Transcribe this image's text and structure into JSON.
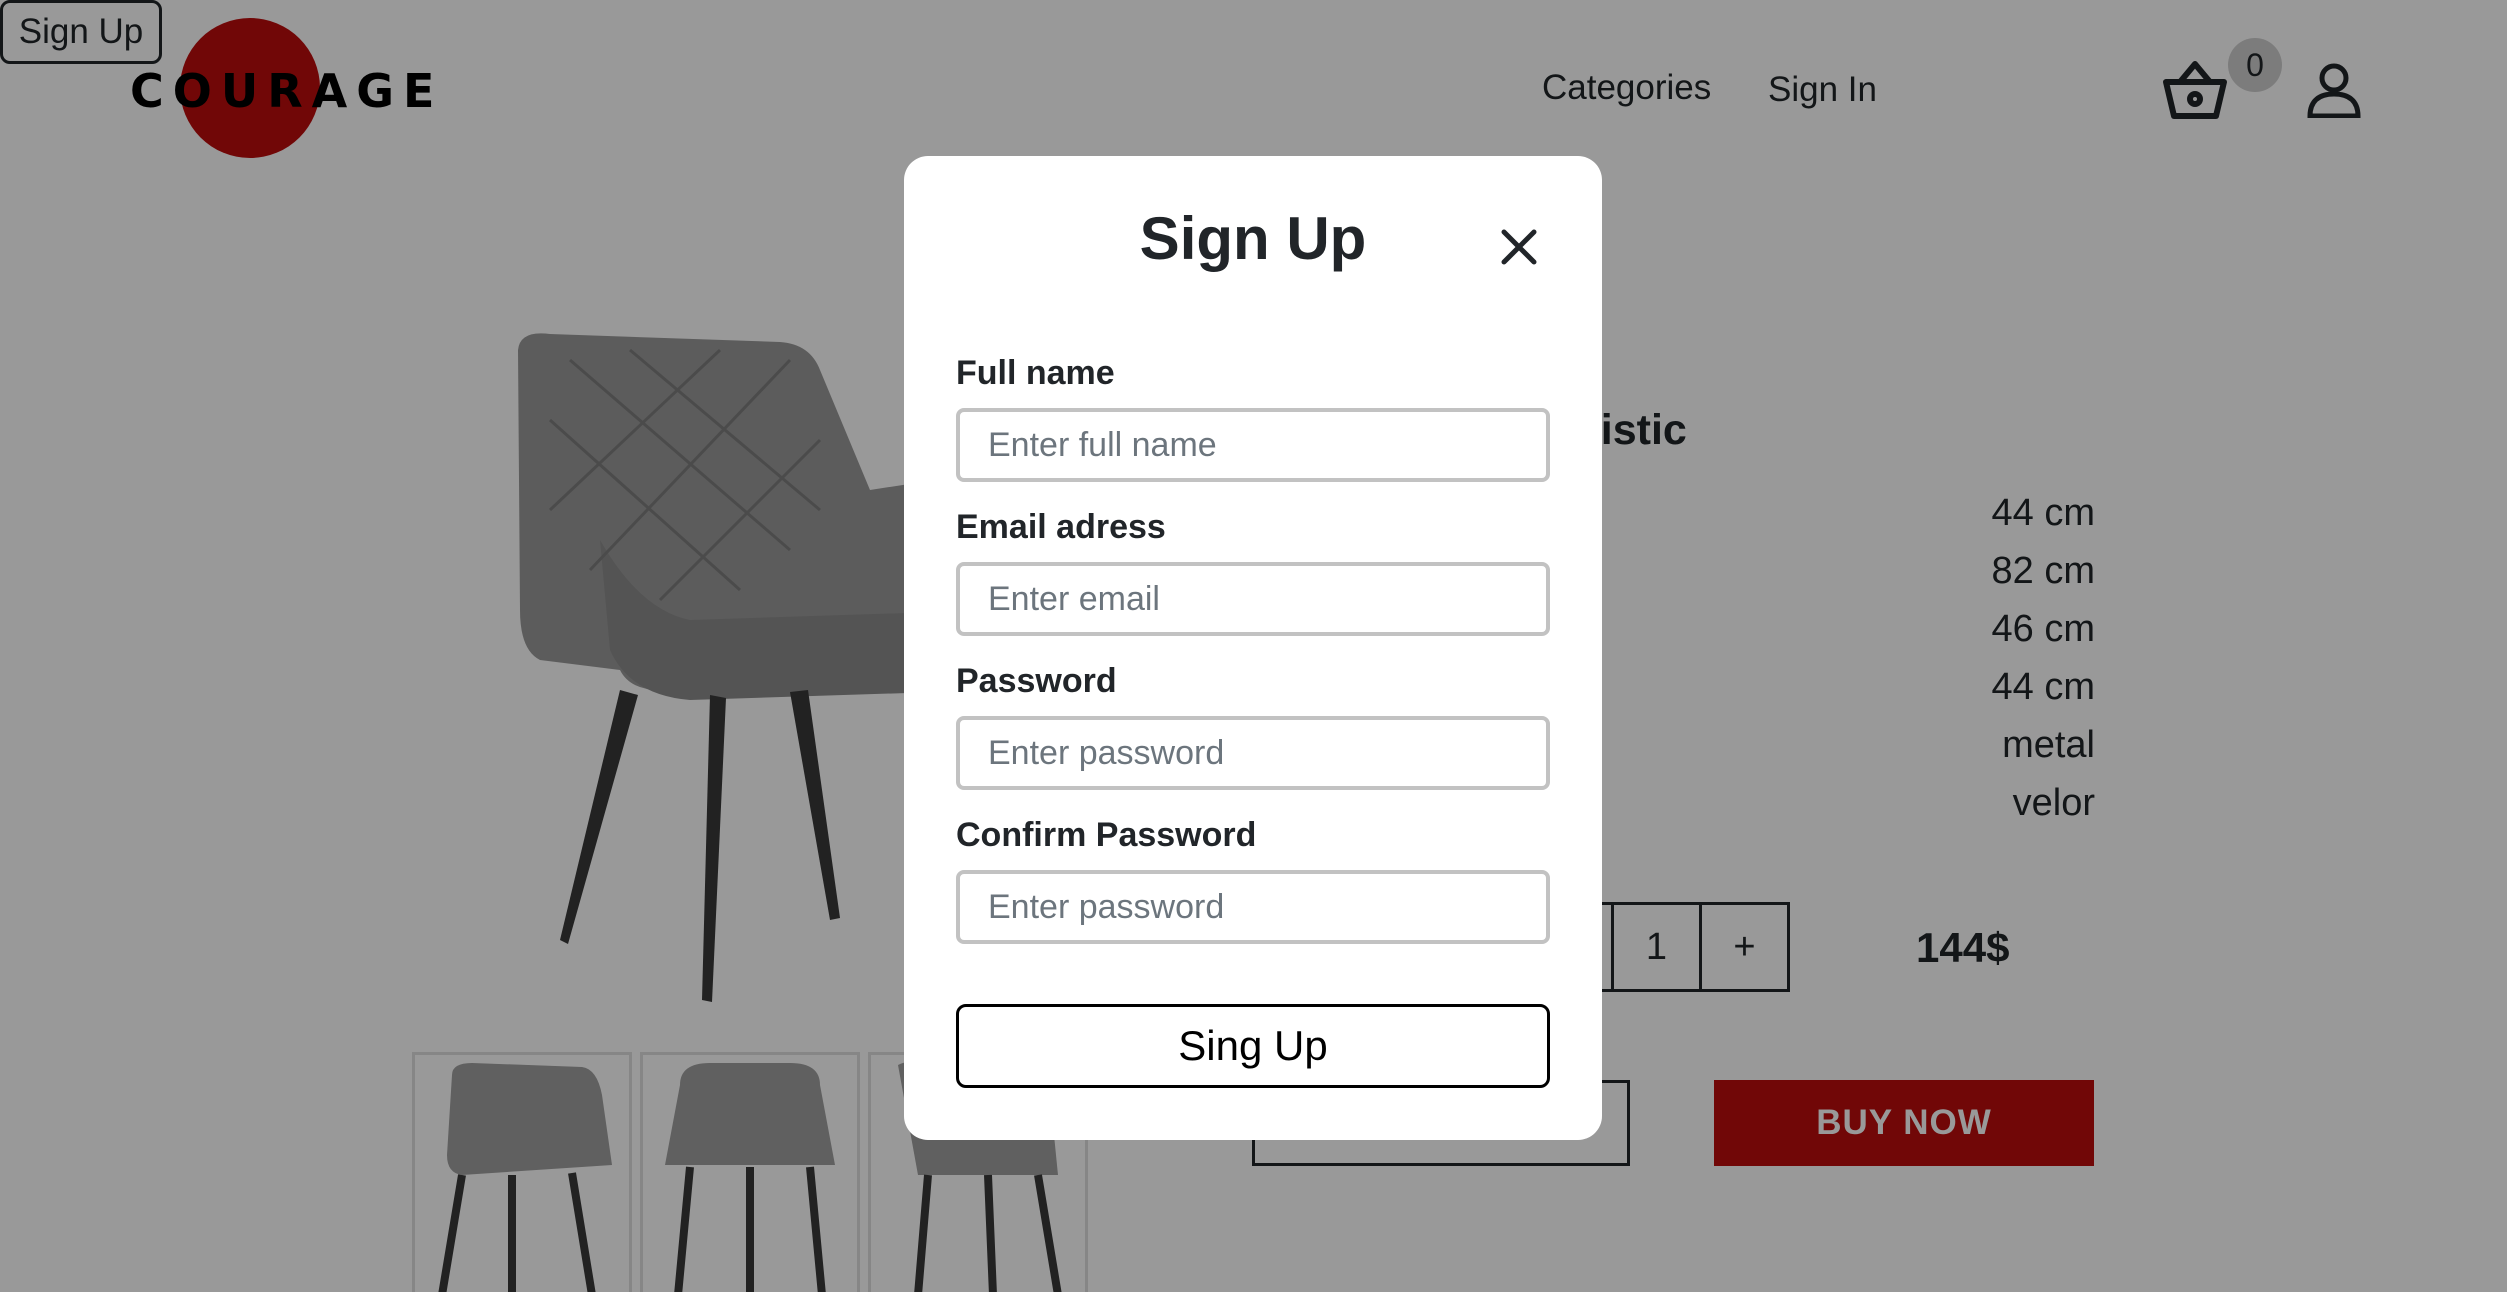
{
  "brand": {
    "logo_text": "COURAGE",
    "accent": "#bd0d0d"
  },
  "header": {
    "nav": {
      "categories": "Categories",
      "sign_in": "Sign In",
      "sign_up": "Sign Up"
    },
    "cart_count": "0",
    "icons": [
      "basket-icon",
      "user-icon"
    ]
  },
  "product": {
    "characteristics_title": "Characteristic",
    "spec_values": [
      "44 cm",
      "82 cm",
      "46 cm",
      "44 cm",
      "metal",
      "velor"
    ],
    "quantity": "1",
    "decrement": "-",
    "increment": "+",
    "price": "144$",
    "buy_now": "BUY NOW",
    "buy_color": "#bd0d0d"
  },
  "modal": {
    "title": "Sign Up",
    "fields": [
      {
        "label": "Full name",
        "placeholder": "Enter full name"
      },
      {
        "label": "Email adress",
        "placeholder": "Enter email"
      },
      {
        "label": "Password",
        "placeholder": "Enter password"
      },
      {
        "label": "Confirm Password",
        "placeholder": "Enter password"
      }
    ],
    "submit": "Sing Up"
  }
}
